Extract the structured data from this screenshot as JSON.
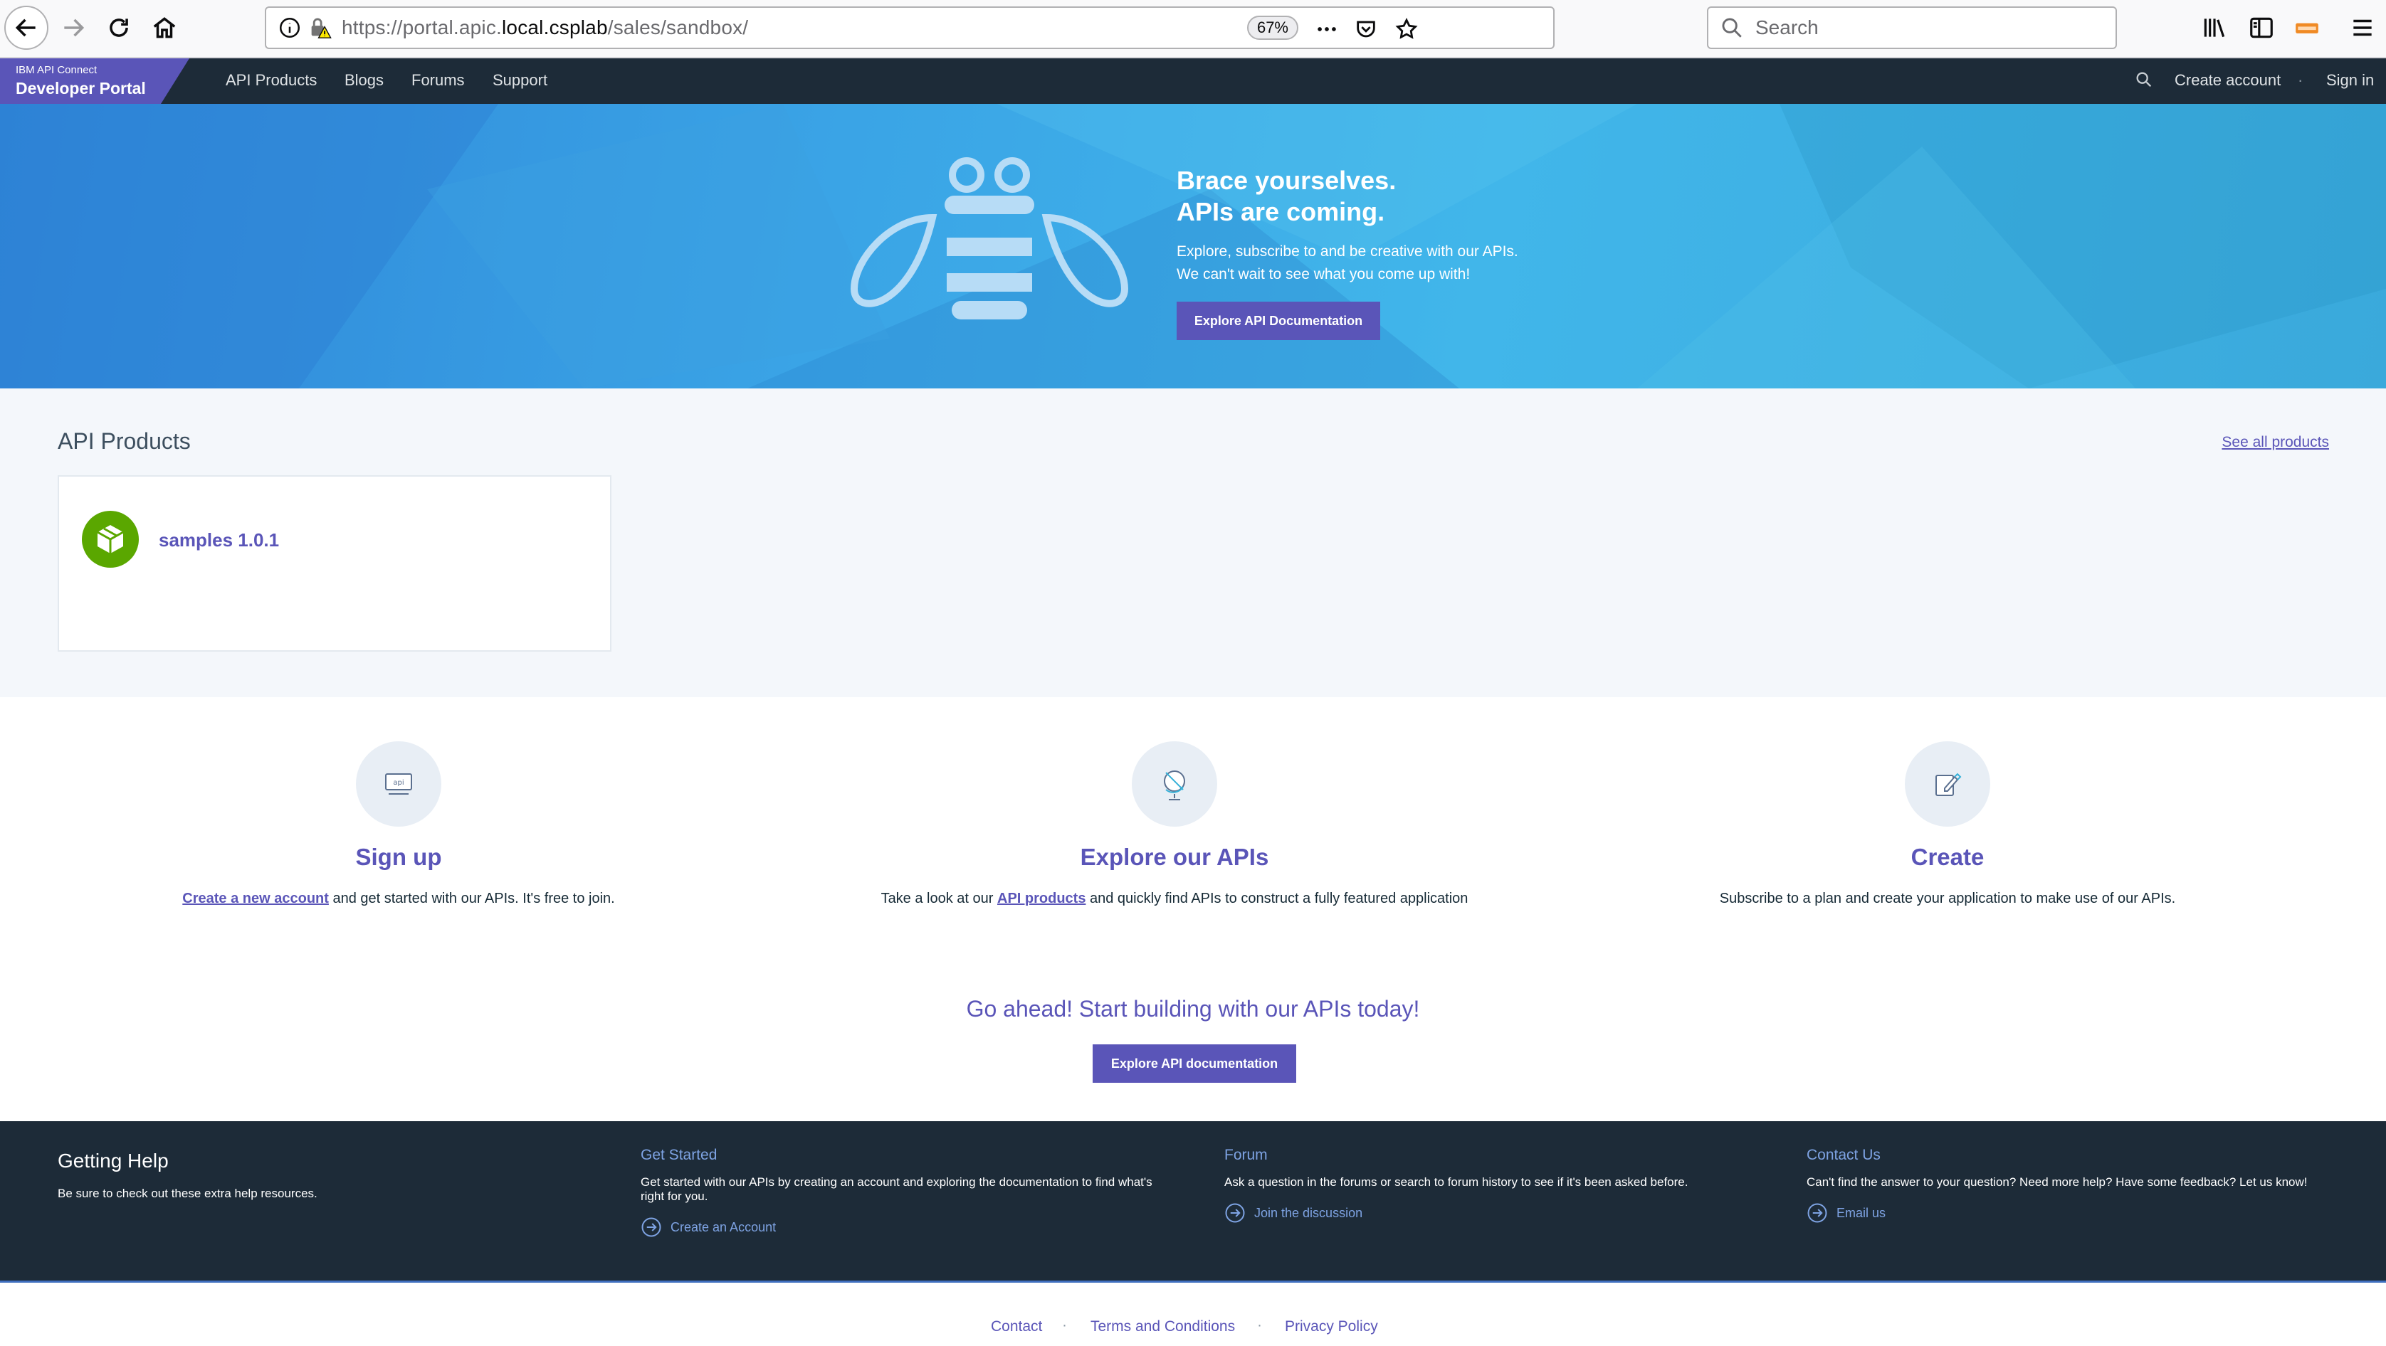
{
  "browser": {
    "url_prefix": "https://portal.apic.",
    "url_host": "local.csplab",
    "url_path": "/sales/sandbox/",
    "zoom": "67%",
    "search_placeholder": "Search"
  },
  "portal_nav": {
    "brand_small": "IBM API Connect",
    "brand_big": "Developer Portal",
    "links": [
      "API Products",
      "Blogs",
      "Forums",
      "Support"
    ],
    "create_account": "Create account",
    "separator": "·",
    "sign_in": "Sign in"
  },
  "hero": {
    "title": "Brace yourselves.\nAPIs are coming.",
    "description": "Explore, subscribe to and be creative with our APIs.\nWe can't wait to see what you come up with!",
    "button": "Explore API Documentation"
  },
  "products": {
    "title": "API Products",
    "see_all": "See all products",
    "items": [
      {
        "name": "samples 1.0.1"
      }
    ]
  },
  "features": [
    {
      "title": "Sign up",
      "link": "Create a new account",
      "text": " and get started with our APIs. It's free to join."
    },
    {
      "title": "Explore our APIs",
      "prefix": "Take a look at our ",
      "link": "API products",
      "text": " and quickly find APIs to construct a fully featured application"
    },
    {
      "title": "Create",
      "text": "Subscribe to a plan and create your application to make use of our APIs."
    }
  ],
  "cta": {
    "title": "Go ahead! Start building with our APIs today!",
    "button": "Explore API documentation"
  },
  "help": {
    "title": "Getting Help",
    "subtitle": "Be sure to check out these extra help resources.",
    "columns": [
      {
        "title": "Get Started",
        "description": "Get started with our APIs by creating an account and exploring the documentation to find what's right for you.",
        "link": "Create an Account"
      },
      {
        "title": "Forum",
        "description": "Ask a question in the forums or search to forum history to see if it's been asked before.",
        "link": "Join the discussion"
      },
      {
        "title": "Contact Us",
        "description": "Can't find the answer to your question? Need more help? Have some feedback? Let us know!",
        "link": "Email us"
      }
    ]
  },
  "footer": {
    "links": [
      "Contact",
      "Terms and Conditions",
      "Privacy Policy"
    ],
    "separator": "·"
  },
  "colors": {
    "brand_purple": "#5a55b8",
    "nav_dark": "#1d2b38",
    "product_green": "#5aa700",
    "hero_blue": "#3aa4e6"
  }
}
